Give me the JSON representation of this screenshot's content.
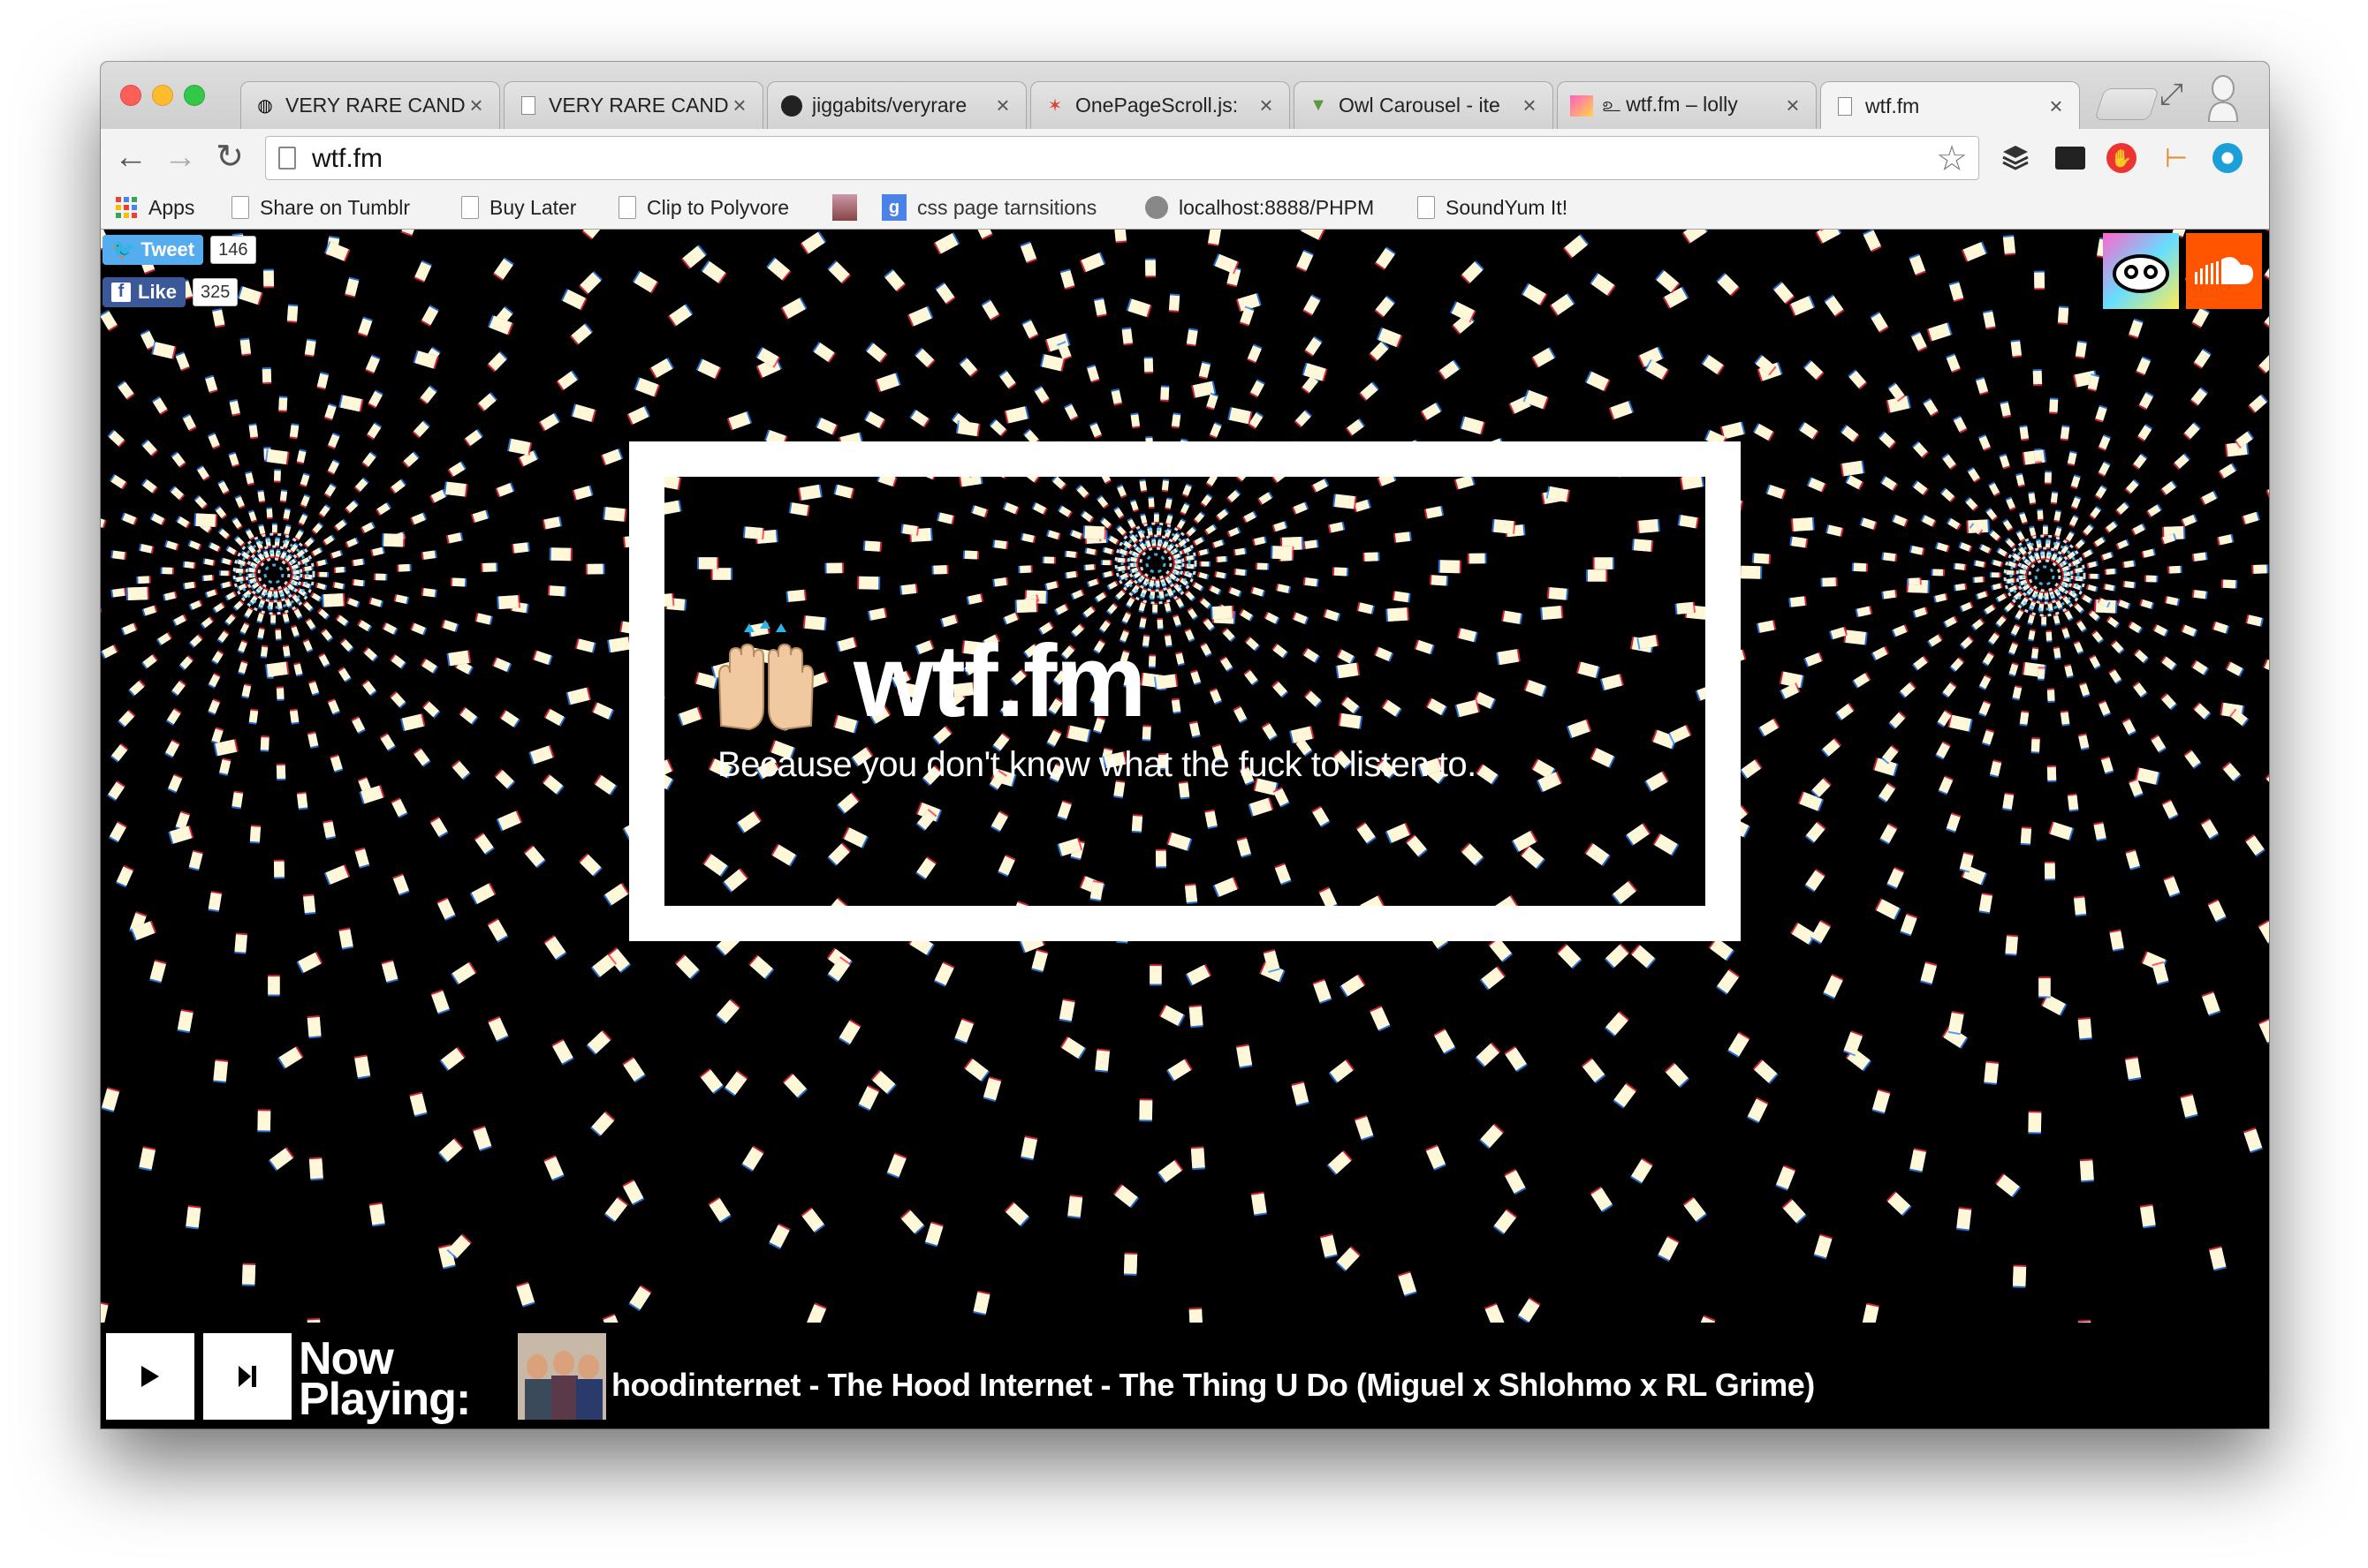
{
  "browser": {
    "tabs": [
      {
        "title": "VERY RARE CANDY",
        "icon": "globe-icon",
        "active": false
      },
      {
        "title": "VERY RARE CANDY",
        "icon": "page-icon",
        "active": false
      },
      {
        "title": "jiggabits/veryrare",
        "icon": "github-icon",
        "active": false
      },
      {
        "title": "OnePageScroll.js:",
        "icon": "star-icon",
        "active": false
      },
      {
        "title": "Owl Carousel - ite",
        "icon": "owl-icon",
        "active": false
      },
      {
        "title": "உ wtf.fm – lolly",
        "icon": "gradient-icon",
        "active": false
      },
      {
        "title": "wtf.fm",
        "icon": "page-icon",
        "active": true
      }
    ],
    "url": "wtf.fm",
    "bookmarks": [
      {
        "label": "Apps",
        "icon": "apps-grid-icon"
      },
      {
        "label": "Share on Tumblr",
        "icon": "page-icon"
      },
      {
        "label": "Buy Later",
        "icon": "page-icon"
      },
      {
        "label": "Clip to Polyvore",
        "icon": "page-icon"
      },
      {
        "label": "css page tarnsitions",
        "icon": "google-icon"
      },
      {
        "label": "localhost:8888/PHPM",
        "icon": "globe-icon"
      },
      {
        "label": "SoundYum It!",
        "icon": "page-icon"
      }
    ]
  },
  "social": {
    "tweet_label": "Tweet",
    "tweet_count": "146",
    "like_label": "Like",
    "like_count": "325"
  },
  "hero": {
    "emoji": "raising-hands-emoji",
    "title": "wtf.fm",
    "subtitle": "Because you don't know what the fuck to listen to."
  },
  "player": {
    "now_line1": "Now",
    "now_line2": "Playing:",
    "track": "hoodinternet - The Hood Internet - The Thing U Do (Miguel x Shlohmo x RL Grime)"
  },
  "colors": {
    "accent_soundcloud": "#ff5500",
    "twitter": "#55acee",
    "facebook": "#3b5998"
  }
}
